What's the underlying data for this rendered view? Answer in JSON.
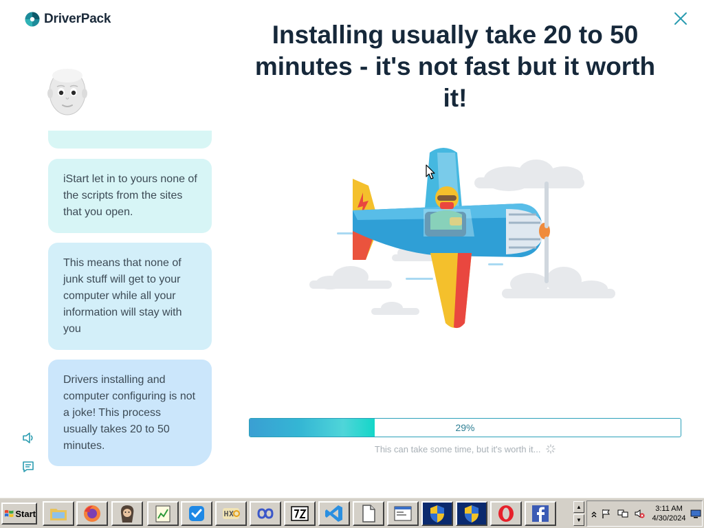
{
  "app": {
    "name": "DriverPack"
  },
  "headline": {
    "text": "Installing usually take 20 to 50 minutes - it's not fast but it worth it!"
  },
  "chat": {
    "messages": [
      "iStart let in to yours none of the scripts from the sites that you open.",
      "This means that none of junk stuff will get to your computer while all your information will stay with you",
      "Drivers installing and computer configuring is not a joke! This process usually takes 20 to 50 minutes."
    ]
  },
  "progress": {
    "value": 29,
    "label": "29%",
    "hint": "This can take some time, but it's worth it..."
  },
  "colors": {
    "accent": "#2aa0b9",
    "brand_dark": "#1b2a3a",
    "bubble1": "#d7f5f6",
    "bubble2": "#d3eff9",
    "bubble3": "#cbe6fb"
  },
  "taskbar": {
    "start_label": "Start",
    "buttons": [
      "explorer-icon",
      "firefox-icon",
      "portrait-icon",
      "notepad-chart-icon",
      "task-check-icon",
      "hxd-icon",
      "infinity-icon",
      "7zip-icon",
      "vscode-icon",
      "file-icon",
      "window-app-icon",
      "uac-shield-icon",
      "uac-shield-icon",
      "opera-icon",
      "facebook-icon"
    ],
    "clock": {
      "time": "3:11 AM",
      "date": "4/30/2024"
    }
  }
}
